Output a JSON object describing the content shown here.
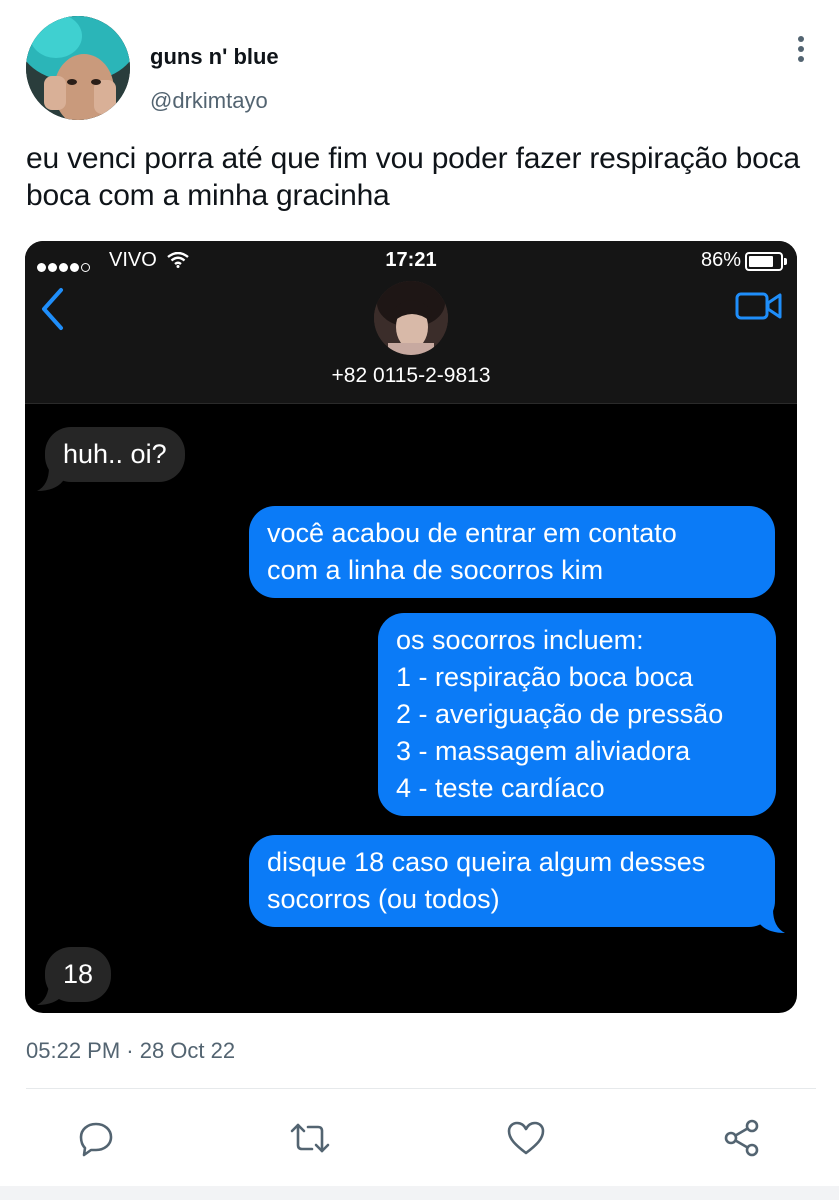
{
  "author": {
    "name": "guns n' blue",
    "handle": "@drkimtayo"
  },
  "tweet": {
    "text": "eu venci porra até que fim vou poder fazer respiração boca boca com a minha gracinha",
    "timestamp": "05:22 PM · 28 Oct 22"
  },
  "screenshot": {
    "status": {
      "carrier": "VIVO",
      "time": "17:21",
      "battery": "86%"
    },
    "contact_number": "+82 0115-2-9813",
    "messages": [
      {
        "from": "them",
        "text": "huh.. oi?"
      },
      {
        "from": "me",
        "lines": [
          "você acabou de entrar em contato",
          "com a linha de socorros kim"
        ]
      },
      {
        "from": "me",
        "lines": [
          "os socorros incluem:",
          "1 - respiração boca boca",
          "2 - averiguação de pressão",
          "3 - massagem aliviadora",
          "4 - teste cardíaco"
        ]
      },
      {
        "from": "me",
        "lines": [
          "disque 18 caso queira algum desses",
          "socorros (ou todos)"
        ]
      },
      {
        "from": "them",
        "text": "18"
      }
    ]
  },
  "actions": [
    "reply-icon",
    "retweet-icon",
    "like-icon",
    "share-icon"
  ],
  "colors": {
    "bubble_out": "#0b7bf7",
    "bubble_in": "#262626",
    "ios_blue": "#1f8efa",
    "muted": "#536471"
  }
}
